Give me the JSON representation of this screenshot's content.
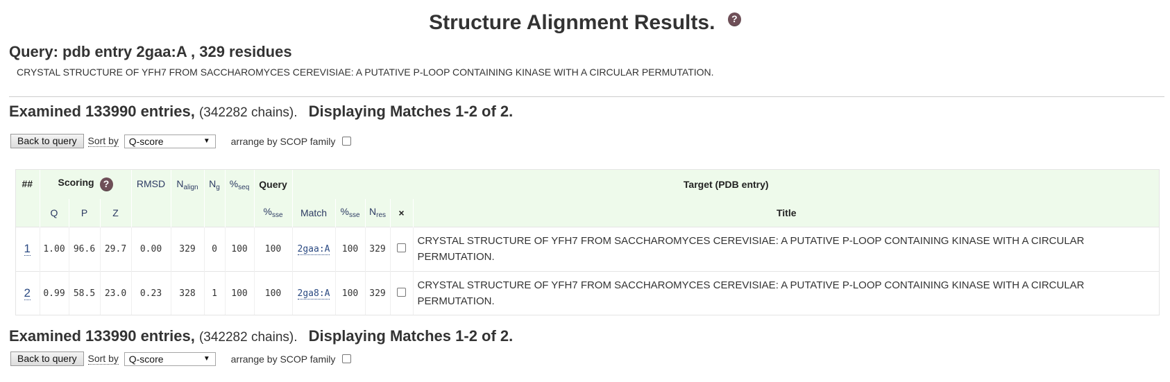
{
  "header": {
    "title": "Structure Alignment Results.",
    "help_icon": "?"
  },
  "query": {
    "heading": "Query: pdb entry 2gaa:A , 329 residues",
    "description": "CRYSTAL STRUCTURE OF YFH7 FROM SACCHAROMYCES CEREVISIAE: A PUTATIVE P-LOOP CONTAINING KINASE WITH A CIRCULAR PERMUTATION."
  },
  "summary": {
    "examined": "Examined 133990 entries,",
    "chains": "(342282 chains).",
    "displaying": "Displaying Matches 1-2 of 2."
  },
  "controls": {
    "back_label": "Back to query",
    "sort_label": "Sort by",
    "sort_value": "Q-score",
    "scop_label": "arrange by SCOP family"
  },
  "table": {
    "header_top": {
      "num": "##",
      "scoring": "Scoring",
      "rmsd": "RMSD",
      "nalign": "N",
      "nalign_sub": "align",
      "ng": "N",
      "ng_sub": "g",
      "seq": "%",
      "seq_sub": "seq",
      "query": "Query",
      "target": "Target (PDB entry)"
    },
    "header_bottom": {
      "q": "Q",
      "p": "P",
      "z": "Z",
      "qsse": "%",
      "qsse_sub": "sse",
      "match": "Match",
      "tsse": "%",
      "tsse_sub": "sse",
      "nres": "N",
      "nres_sub": "res",
      "x": "×",
      "title": "Title"
    },
    "rows": [
      {
        "num": "1",
        "q": "1.00",
        "p": "96.6",
        "z": "29.7",
        "rmsd": "0.00",
        "nalign": "329",
        "ng": "0",
        "seq": "100",
        "qsse": "100",
        "match": "2gaa:A",
        "tsse": "100",
        "nres": "329",
        "title": "CRYSTAL STRUCTURE OF YFH7 FROM SACCHAROMYCES CEREVISIAE: A PUTATIVE P-LOOP CONTAINING KINASE WITH A CIRCULAR PERMUTATION."
      },
      {
        "num": "2",
        "q": "0.99",
        "p": "58.5",
        "z": "23.0",
        "rmsd": "0.23",
        "nalign": "328",
        "ng": "1",
        "seq": "100",
        "qsse": "100",
        "match": "2ga8:A",
        "tsse": "100",
        "nres": "329",
        "title": "CRYSTAL STRUCTURE OF YFH7 FROM SACCHAROMYCES CEREVISIAE: A PUTATIVE P-LOOP CONTAINING KINASE WITH A CIRCULAR PERMUTATION."
      }
    ]
  },
  "colors": {
    "header_bg": "#eefaeb",
    "link": "#2b4a82",
    "help_icon_bg": "#6e4f57"
  }
}
